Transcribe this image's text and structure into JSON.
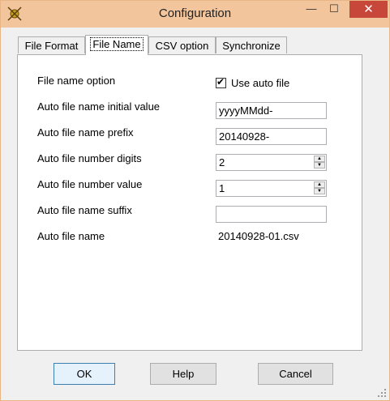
{
  "window": {
    "title": "Configuration",
    "minimize": "—",
    "maximize": "☐",
    "close": "✕"
  },
  "tabs": [
    {
      "label": "File Format"
    },
    {
      "label": "File Name"
    },
    {
      "label": "CSV option"
    },
    {
      "label": "Synchronize"
    }
  ],
  "form": {
    "file_name_option": {
      "label": "File name option",
      "checkbox_label": "Use auto file",
      "checked": true
    },
    "initial_value": {
      "label": "Auto file name initial value",
      "value": "yyyyMMdd-"
    },
    "prefix": {
      "label": "Auto file name prefix",
      "value": "20140928-"
    },
    "digits": {
      "label": "Auto file number digits",
      "value": "2"
    },
    "number_value": {
      "label": "Auto file number value",
      "value": "1"
    },
    "suffix": {
      "label": "Auto file name suffix",
      "value": ""
    },
    "auto_name": {
      "label": "Auto file name",
      "value": "20140928-01.csv"
    }
  },
  "buttons": {
    "ok": "OK",
    "help": "Help",
    "cancel": "Cancel"
  },
  "colors": {
    "titlebar": "#f3c59d",
    "close": "#c7473a",
    "default_button_border": "#3c7fb1"
  }
}
